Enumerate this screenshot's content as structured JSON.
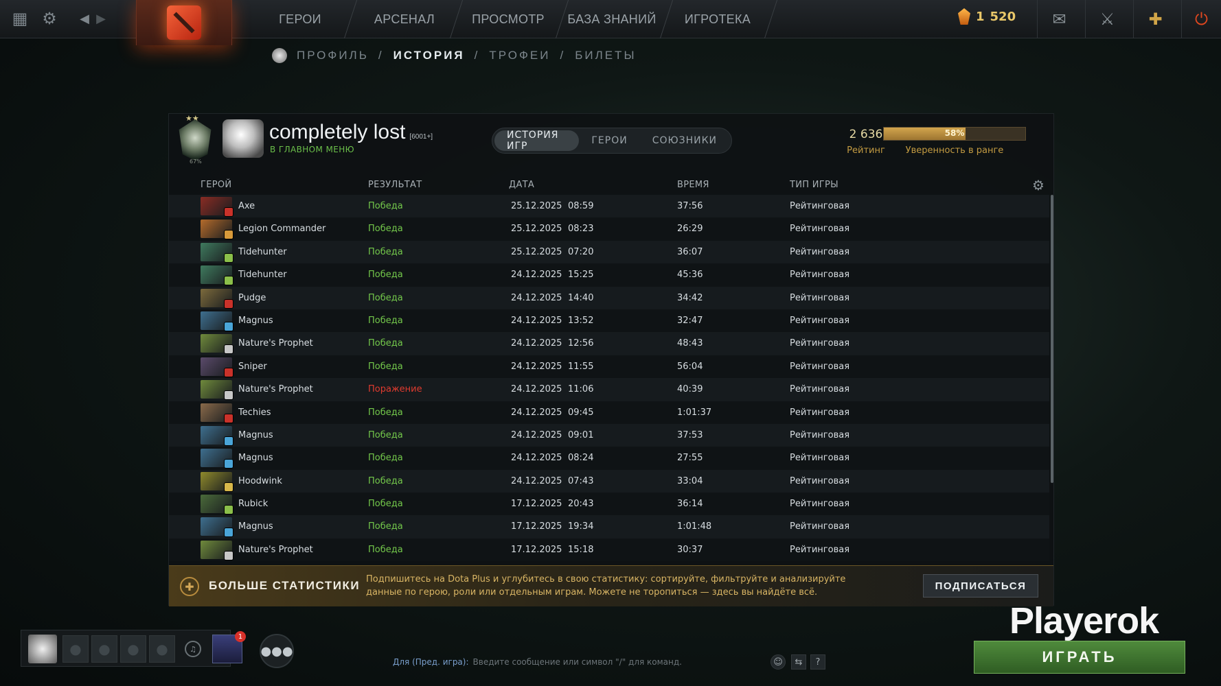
{
  "topnav": {
    "tabs": [
      "ГЕРОИ",
      "АРСЕНАЛ",
      "ПРОСМОТР",
      "БАЗА ЗНАНИЙ",
      "ИГРОТЕКА"
    ],
    "currency_main": "1",
    "currency_sub": "520"
  },
  "breadcrumb": {
    "items": [
      "ПРОФИЛЬ",
      "ИСТОРИЯ",
      "ТРОФЕИ",
      "БИЛЕТЫ"
    ],
    "separator": "/",
    "active_index": 1
  },
  "profile": {
    "rank_small": "67%",
    "name": "completely lost",
    "id_tag": "[6001+]",
    "status": "В ГЛАВНОМ МЕНЮ",
    "tabs": [
      "ИСТОРИЯ ИГР",
      "ГЕРОИ",
      "СОЮЗНИКИ"
    ],
    "rating_value": "2 636",
    "rating_label": "Рейтинг",
    "confidence_pct": "58%",
    "confidence_fraction": 0.58,
    "confidence_label": "Уверенность в ранге"
  },
  "table": {
    "headers": {
      "hero": "ГЕРОЙ",
      "result": "РЕЗУЛЬТАТ",
      "date": "ДАТА",
      "time": "ВРЕМЯ",
      "type": "ТИП ИГРЫ"
    },
    "rows": [
      {
        "hero": "Axe",
        "result": "Победа",
        "win": true,
        "date": "25.12.2025",
        "clock": "08:59",
        "duration": "37:56",
        "type": "Рейтинговая",
        "color": "#8a2c24",
        "attr": "#c9322a"
      },
      {
        "hero": "Legion Commander",
        "result": "Победа",
        "win": true,
        "date": "25.12.2025",
        "clock": "08:23",
        "duration": "26:29",
        "type": "Рейтинговая",
        "color": "#b56b2b",
        "attr": "#d89a3a"
      },
      {
        "hero": "Tidehunter",
        "result": "Победа",
        "win": true,
        "date": "25.12.2025",
        "clock": "07:20",
        "duration": "36:07",
        "type": "Рейтинговая",
        "color": "#3f7a5e",
        "attr": "#8bbf4a"
      },
      {
        "hero": "Tidehunter",
        "result": "Победа",
        "win": true,
        "date": "24.12.2025",
        "clock": "15:25",
        "duration": "45:36",
        "type": "Рейтинговая",
        "color": "#3f7a5e",
        "attr": "#8bbf4a"
      },
      {
        "hero": "Pudge",
        "result": "Победа",
        "win": true,
        "date": "24.12.2025",
        "clock": "14:40",
        "duration": "34:42",
        "type": "Рейтинговая",
        "color": "#7c6a3c",
        "attr": "#c9322a"
      },
      {
        "hero": "Magnus",
        "result": "Победа",
        "win": true,
        "date": "24.12.2025",
        "clock": "13:52",
        "duration": "32:47",
        "type": "Рейтинговая",
        "color": "#3e6f8f",
        "attr": "#4aa5d8"
      },
      {
        "hero": "Nature's Prophet",
        "result": "Победа",
        "win": true,
        "date": "24.12.2025",
        "clock": "12:56",
        "duration": "48:43",
        "type": "Рейтинговая",
        "color": "#6f8a3c",
        "attr": "#c7c7c7"
      },
      {
        "hero": "Sniper",
        "result": "Победа",
        "win": true,
        "date": "24.12.2025",
        "clock": "11:55",
        "duration": "56:04",
        "type": "Рейтинговая",
        "color": "#5a4a6a",
        "attr": "#c9322a"
      },
      {
        "hero": "Nature's Prophet",
        "result": "Поражение",
        "win": false,
        "date": "24.12.2025",
        "clock": "11:06",
        "duration": "40:39",
        "type": "Рейтинговая",
        "color": "#6f8a3c",
        "attr": "#c7c7c7"
      },
      {
        "hero": "Techies",
        "result": "Победа",
        "win": true,
        "date": "24.12.2025",
        "clock": "09:45",
        "duration": "1:01:37",
        "type": "Рейтинговая",
        "color": "#8a6a4a",
        "attr": "#c9322a"
      },
      {
        "hero": "Magnus",
        "result": "Победа",
        "win": true,
        "date": "24.12.2025",
        "clock": "09:01",
        "duration": "37:53",
        "type": "Рейтинговая",
        "color": "#3e6f8f",
        "attr": "#4aa5d8"
      },
      {
        "hero": "Magnus",
        "result": "Победа",
        "win": true,
        "date": "24.12.2025",
        "clock": "08:24",
        "duration": "27:55",
        "type": "Рейтинговая",
        "color": "#3e6f8f",
        "attr": "#4aa5d8"
      },
      {
        "hero": "Hoodwink",
        "result": "Победа",
        "win": true,
        "date": "24.12.2025",
        "clock": "07:43",
        "duration": "33:04",
        "type": "Рейтинговая",
        "color": "#8f8a2c",
        "attr": "#d8b84a"
      },
      {
        "hero": "Rubick",
        "result": "Победа",
        "win": true,
        "date": "17.12.2025",
        "clock": "20:43",
        "duration": "36:14",
        "type": "Рейтинговая",
        "color": "#4a6a3a",
        "attr": "#8bbf4a"
      },
      {
        "hero": "Magnus",
        "result": "Победа",
        "win": true,
        "date": "17.12.2025",
        "clock": "19:34",
        "duration": "1:01:48",
        "type": "Рейтинговая",
        "color": "#3e6f8f",
        "attr": "#4aa5d8"
      },
      {
        "hero": "Nature's Prophet",
        "result": "Победа",
        "win": true,
        "date": "17.12.2025",
        "clock": "15:18",
        "duration": "30:37",
        "type": "Рейтинговая",
        "color": "#6f8a3c",
        "attr": "#c7c7c7"
      }
    ]
  },
  "banner": {
    "title": "БОЛЬШЕ СТАТИСТИКИ",
    "text": "Подпишитесь на Dota Plus и углубитесь в свою статистику: сортируйте, фильтруйте и анализируйте данные по герою, роли или отдельным играм. Можете не торопиться — здесь вы найдёте всё.",
    "button": "ПОДПИСАТЬСЯ"
  },
  "bottom": {
    "notif_count": "1",
    "chat_channel": "Для (Пред. игра):",
    "chat_placeholder": "Введите сообщение или символ \"/\" для команд.",
    "brand": "Playerok",
    "play_label": "ИГРАТЬ"
  }
}
